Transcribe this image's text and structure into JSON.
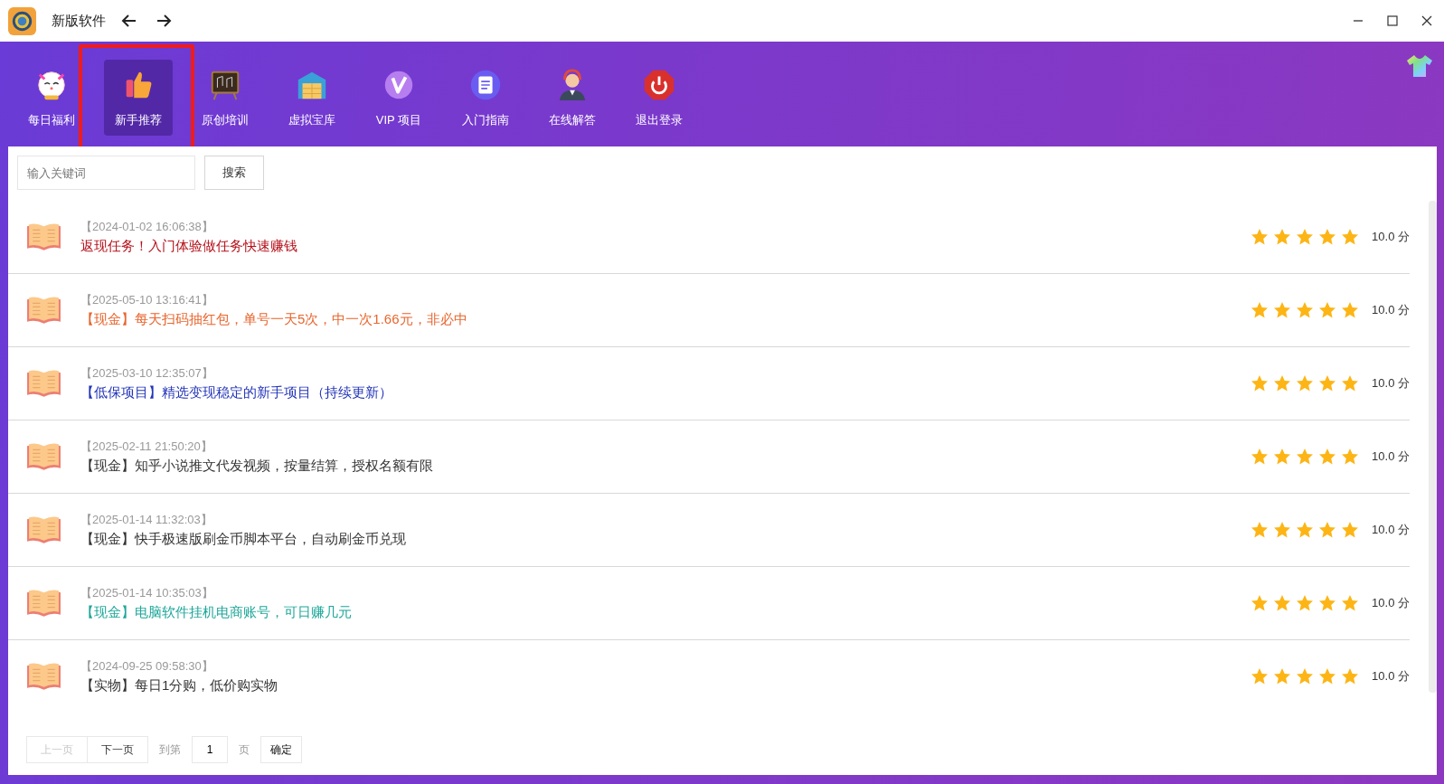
{
  "window": {
    "title": "新版软件"
  },
  "tabs": [
    {
      "label": "每日福利",
      "selected": false,
      "highlighted": false
    },
    {
      "label": "新手推荐",
      "selected": true,
      "highlighted": true
    },
    {
      "label": "原创培训",
      "selected": false,
      "highlighted": false
    },
    {
      "label": "虚拟宝库",
      "selected": false,
      "highlighted": false
    },
    {
      "label": "VIP 项目",
      "selected": false,
      "highlighted": false
    },
    {
      "label": "入门指南",
      "selected": false,
      "highlighted": false
    },
    {
      "label": "在线解答",
      "selected": false,
      "highlighted": false
    },
    {
      "label": "退出登录",
      "selected": false,
      "highlighted": false
    }
  ],
  "search": {
    "placeholder": "输入关键词",
    "button": "搜索"
  },
  "items": [
    {
      "time": "【2024-01-02 16:06:38】",
      "title": "返现任务！入门体验做任务快速赚钱",
      "color": "#b5121b",
      "stars": 5,
      "score": "10.0 分"
    },
    {
      "time": "【2025-05-10 13:16:41】",
      "title": "【现金】每天扫码抽红包，单号一天5次，中一次1.66元，非必中",
      "color": "#e8662e",
      "stars": 5,
      "score": "10.0 分"
    },
    {
      "time": "【2025-03-10 12:35:07】",
      "title": "【低保项目】精选变现稳定的新手项目（持续更新）",
      "color": "#2234b8",
      "stars": 5,
      "score": "10.0 分"
    },
    {
      "time": "【2025-02-11 21:50:20】",
      "title": "【现金】知乎小说推文代发视频，按量结算，授权名额有限",
      "color": "#333333",
      "stars": 5,
      "score": "10.0 分"
    },
    {
      "time": "【2025-01-14 11:32:03】",
      "title": "【现金】快手极速版刷金币脚本平台，自动刷金币兑现",
      "color": "#333333",
      "stars": 5,
      "score": "10.0 分"
    },
    {
      "time": "【2025-01-14 10:35:03】",
      "title": "【现金】电脑软件挂机电商账号，可日赚几元",
      "color": "#1fa79a",
      "stars": 5,
      "score": "10.0 分"
    },
    {
      "time": "【2024-09-25 09:58:30】",
      "title": "【实物】每日1分购，低价购实物",
      "color": "#333333",
      "stars": 5,
      "score": "10.0 分"
    }
  ],
  "pager": {
    "prev": {
      "label": "上一页",
      "disabled": true
    },
    "next": {
      "label": "下一页",
      "disabled": false
    },
    "goto": "到第",
    "page": "1",
    "unit": "页",
    "confirm": "确定"
  }
}
